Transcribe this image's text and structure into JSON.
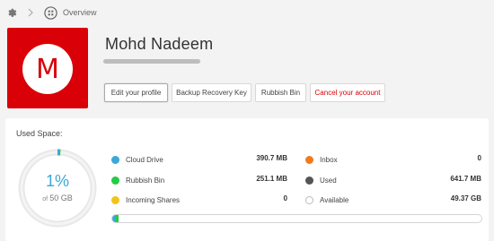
{
  "breadcrumb": {
    "icons": [
      "gear-icon",
      "chevron-right-icon",
      "grid-circle-icon"
    ],
    "current": "Overview"
  },
  "profile": {
    "avatar_letter": "M",
    "avatar_color": "#d90007",
    "name": "Mohd Nadeem",
    "buttons": {
      "edit": "Edit your profile",
      "backup": "Backup Recovery Key",
      "rubbish": "Rubbish Bin",
      "cancel": "Cancel your account"
    }
  },
  "storage": {
    "title": "Used Space:",
    "percent": "1%",
    "of_label": "of",
    "total": "50 GB",
    "used_fraction": 0.01,
    "legend": {
      "cloud_drive": {
        "label": "Cloud Drive",
        "value": "390.7 MB",
        "color": "#3aa8d8"
      },
      "rubbish_bin": {
        "label": "Rubbish Bin",
        "value": "251.1 MB",
        "color": "#22cc44"
      },
      "incoming_shares": {
        "label": "Incoming Shares",
        "value": "0",
        "color": "#f0c419"
      },
      "inbox": {
        "label": "Inbox",
        "value": "0",
        "color": "#f07b1f"
      },
      "used": {
        "label": "Used",
        "value": "641.7 MB",
        "color": "#555555"
      },
      "available": {
        "label": "Available",
        "value": "49.37 GB",
        "color": "#ffffff"
      }
    },
    "bar_fractions": {
      "cloud_drive": 0.0078,
      "rubbish_bin": 0.005
    }
  }
}
